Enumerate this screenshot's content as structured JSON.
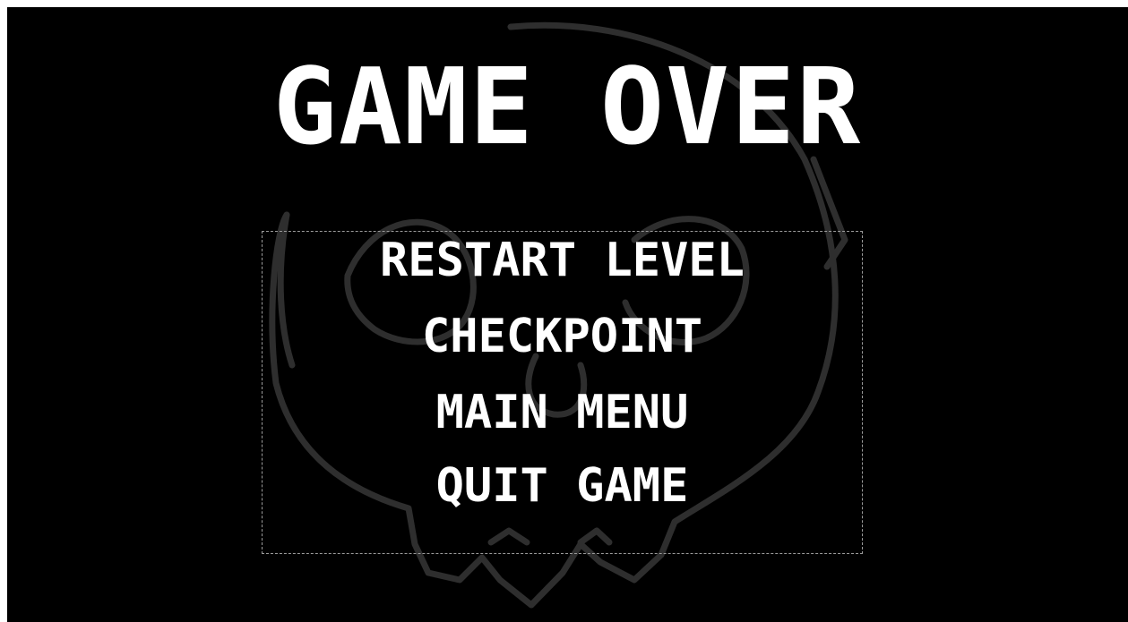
{
  "title": "GAME OVER",
  "menu": {
    "items": [
      {
        "label": "RESTART LEVEL"
      },
      {
        "label": "CHECKPOINT"
      },
      {
        "label": "MAIN MENU"
      },
      {
        "label": "QUIT GAME"
      }
    ]
  },
  "colors": {
    "background": "#000000",
    "text": "#ffffff",
    "skull_outline": "#2e2e2e",
    "menu_border": "#9a9a9a"
  },
  "icons": {
    "background_art": "skull-outline-icon"
  }
}
